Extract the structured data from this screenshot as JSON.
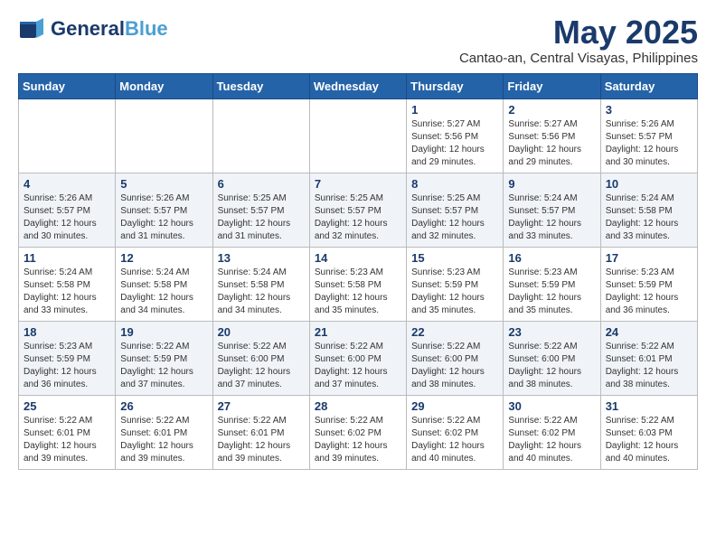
{
  "header": {
    "logo_line1": "General",
    "logo_line2": "Blue",
    "title": "May 2025",
    "subtitle": "Cantao-an, Central Visayas, Philippines"
  },
  "weekdays": [
    "Sunday",
    "Monday",
    "Tuesday",
    "Wednesday",
    "Thursday",
    "Friday",
    "Saturday"
  ],
  "weeks": [
    [
      {
        "day": "",
        "info": ""
      },
      {
        "day": "",
        "info": ""
      },
      {
        "day": "",
        "info": ""
      },
      {
        "day": "",
        "info": ""
      },
      {
        "day": "1",
        "info": "Sunrise: 5:27 AM\nSunset: 5:56 PM\nDaylight: 12 hours\nand 29 minutes."
      },
      {
        "day": "2",
        "info": "Sunrise: 5:27 AM\nSunset: 5:56 PM\nDaylight: 12 hours\nand 29 minutes."
      },
      {
        "day": "3",
        "info": "Sunrise: 5:26 AM\nSunset: 5:57 PM\nDaylight: 12 hours\nand 30 minutes."
      }
    ],
    [
      {
        "day": "4",
        "info": "Sunrise: 5:26 AM\nSunset: 5:57 PM\nDaylight: 12 hours\nand 30 minutes."
      },
      {
        "day": "5",
        "info": "Sunrise: 5:26 AM\nSunset: 5:57 PM\nDaylight: 12 hours\nand 31 minutes."
      },
      {
        "day": "6",
        "info": "Sunrise: 5:25 AM\nSunset: 5:57 PM\nDaylight: 12 hours\nand 31 minutes."
      },
      {
        "day": "7",
        "info": "Sunrise: 5:25 AM\nSunset: 5:57 PM\nDaylight: 12 hours\nand 32 minutes."
      },
      {
        "day": "8",
        "info": "Sunrise: 5:25 AM\nSunset: 5:57 PM\nDaylight: 12 hours\nand 32 minutes."
      },
      {
        "day": "9",
        "info": "Sunrise: 5:24 AM\nSunset: 5:57 PM\nDaylight: 12 hours\nand 33 minutes."
      },
      {
        "day": "10",
        "info": "Sunrise: 5:24 AM\nSunset: 5:58 PM\nDaylight: 12 hours\nand 33 minutes."
      }
    ],
    [
      {
        "day": "11",
        "info": "Sunrise: 5:24 AM\nSunset: 5:58 PM\nDaylight: 12 hours\nand 33 minutes."
      },
      {
        "day": "12",
        "info": "Sunrise: 5:24 AM\nSunset: 5:58 PM\nDaylight: 12 hours\nand 34 minutes."
      },
      {
        "day": "13",
        "info": "Sunrise: 5:24 AM\nSunset: 5:58 PM\nDaylight: 12 hours\nand 34 minutes."
      },
      {
        "day": "14",
        "info": "Sunrise: 5:23 AM\nSunset: 5:58 PM\nDaylight: 12 hours\nand 35 minutes."
      },
      {
        "day": "15",
        "info": "Sunrise: 5:23 AM\nSunset: 5:59 PM\nDaylight: 12 hours\nand 35 minutes."
      },
      {
        "day": "16",
        "info": "Sunrise: 5:23 AM\nSunset: 5:59 PM\nDaylight: 12 hours\nand 35 minutes."
      },
      {
        "day": "17",
        "info": "Sunrise: 5:23 AM\nSunset: 5:59 PM\nDaylight: 12 hours\nand 36 minutes."
      }
    ],
    [
      {
        "day": "18",
        "info": "Sunrise: 5:23 AM\nSunset: 5:59 PM\nDaylight: 12 hours\nand 36 minutes."
      },
      {
        "day": "19",
        "info": "Sunrise: 5:22 AM\nSunset: 5:59 PM\nDaylight: 12 hours\nand 37 minutes."
      },
      {
        "day": "20",
        "info": "Sunrise: 5:22 AM\nSunset: 6:00 PM\nDaylight: 12 hours\nand 37 minutes."
      },
      {
        "day": "21",
        "info": "Sunrise: 5:22 AM\nSunset: 6:00 PM\nDaylight: 12 hours\nand 37 minutes."
      },
      {
        "day": "22",
        "info": "Sunrise: 5:22 AM\nSunset: 6:00 PM\nDaylight: 12 hours\nand 38 minutes."
      },
      {
        "day": "23",
        "info": "Sunrise: 5:22 AM\nSunset: 6:00 PM\nDaylight: 12 hours\nand 38 minutes."
      },
      {
        "day": "24",
        "info": "Sunrise: 5:22 AM\nSunset: 6:01 PM\nDaylight: 12 hours\nand 38 minutes."
      }
    ],
    [
      {
        "day": "25",
        "info": "Sunrise: 5:22 AM\nSunset: 6:01 PM\nDaylight: 12 hours\nand 39 minutes."
      },
      {
        "day": "26",
        "info": "Sunrise: 5:22 AM\nSunset: 6:01 PM\nDaylight: 12 hours\nand 39 minutes."
      },
      {
        "day": "27",
        "info": "Sunrise: 5:22 AM\nSunset: 6:01 PM\nDaylight: 12 hours\nand 39 minutes."
      },
      {
        "day": "28",
        "info": "Sunrise: 5:22 AM\nSunset: 6:02 PM\nDaylight: 12 hours\nand 39 minutes."
      },
      {
        "day": "29",
        "info": "Sunrise: 5:22 AM\nSunset: 6:02 PM\nDaylight: 12 hours\nand 40 minutes."
      },
      {
        "day": "30",
        "info": "Sunrise: 5:22 AM\nSunset: 6:02 PM\nDaylight: 12 hours\nand 40 minutes."
      },
      {
        "day": "31",
        "info": "Sunrise: 5:22 AM\nSunset: 6:03 PM\nDaylight: 12 hours\nand 40 minutes."
      }
    ]
  ]
}
